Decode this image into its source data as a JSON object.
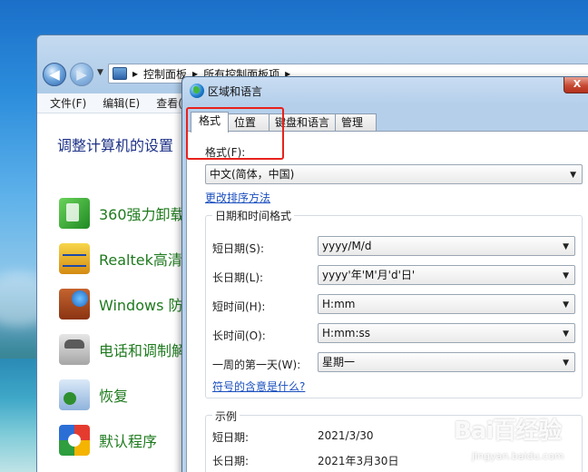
{
  "controlPanel": {
    "breadcrumb": [
      "控制面板",
      "所有控制面板项"
    ],
    "menu": [
      "文件(F)",
      "编辑(E)",
      "查看(V)"
    ],
    "heading": "调整计算机的设置",
    "items": [
      "360强力卸载",
      "Realtek高清晰",
      "Windows 防",
      "电话和调制解",
      "恢复",
      "默认程序"
    ]
  },
  "dialog": {
    "title": "区域和语言",
    "close_label": "X",
    "tabs": [
      "格式",
      "位置",
      "键盘和语言",
      "管理"
    ],
    "format_label": "格式(F):",
    "format_value": "中文(简体，中国)",
    "sort_link": "更改排序方法",
    "datetime_group_title": "日期和时间格式",
    "rows": [
      {
        "label": "短日期(S):",
        "value": "yyyy/M/d"
      },
      {
        "label": "长日期(L):",
        "value": "yyyy'年'M'月'd'日'"
      },
      {
        "label": "短时间(H):",
        "value": "H:mm"
      },
      {
        "label": "长时间(O):",
        "value": "H:mm:ss"
      },
      {
        "label": "一周的第一天(W):",
        "value": "星期一"
      }
    ],
    "notation_link": "符号的含意是什么?",
    "example_title": "示例",
    "examples": [
      {
        "label": "短日期:",
        "value": "2021/3/30"
      },
      {
        "label": "长日期:",
        "value": "2021年3月30日"
      }
    ]
  },
  "watermark": {
    "main": "Bai百经验",
    "sub": "jingyan.baidu.com"
  }
}
